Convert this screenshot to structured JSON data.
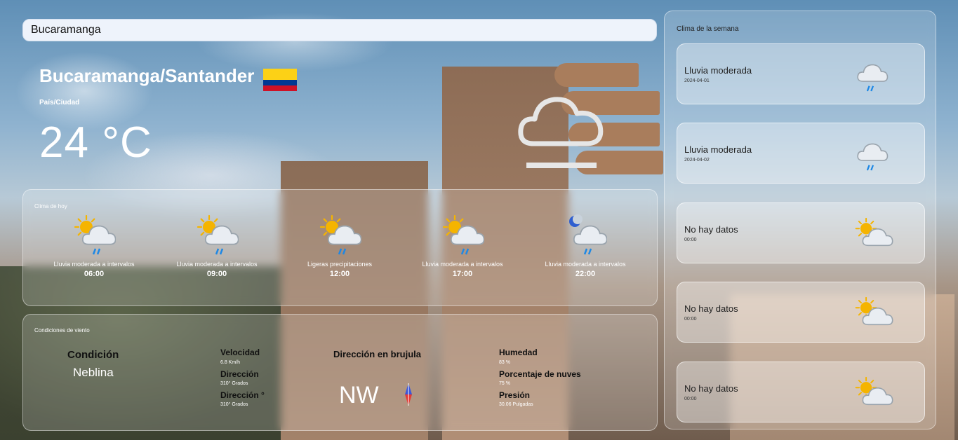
{
  "search": {
    "value": "Bucaramanga"
  },
  "location": {
    "title": "Bucaramanga/Santander",
    "label": "País/Ciudad",
    "temperature": "24 °C",
    "flag_icon": "colombia-flag-icon",
    "icon": "fog-icon"
  },
  "hourly": {
    "title": "Clima de hoy",
    "items": [
      {
        "condition": "Lluvia moderada a intervalos",
        "time": "06:00",
        "icon": "sun-cloud-rain-icon"
      },
      {
        "condition": "Lluvia moderada a intervalos",
        "time": "09:00",
        "icon": "sun-cloud-rain-icon"
      },
      {
        "condition": "Ligeras precipitaciones",
        "time": "12:00",
        "icon": "sun-cloud-rain-icon"
      },
      {
        "condition": "Lluvia moderada a intervalos",
        "time": "17:00",
        "icon": "sun-cloud-rain-icon"
      },
      {
        "condition": "Lluvia moderada a intervalos",
        "time": "22:00",
        "icon": "moon-cloud-rain-icon"
      }
    ]
  },
  "wind": {
    "title": "Condiciones de viento",
    "condicion_label": "Condición",
    "condicion_value": "Neblina",
    "velocidad_label": "Velocidad",
    "velocidad_value": "6.8 Km/h",
    "direccion_label": "Dirección",
    "direccion_value": "310° Grados",
    "direccion2_label": "Dirección °",
    "direccion2_value": "310° Grados",
    "brujula_label": "Dirección en brujula",
    "brujula_value": "NW",
    "humedad_label": "Humedad",
    "humedad_value": "83 %",
    "nubes_label": "Porcentaje de nuves",
    "nubes_value": "75 %",
    "presion_label": "Presión",
    "presion_value": "30.06 Pulgadas"
  },
  "weekly": {
    "title": "Clima de la semana",
    "days": [
      {
        "condition": "Lluvia moderada",
        "date": "2024-04-01",
        "icon": "cloud-rain-icon"
      },
      {
        "condition": "Lluvia moderada",
        "date": "2024-04-02",
        "icon": "cloud-rain-icon"
      },
      {
        "condition": "No hay datos",
        "date": "00:00",
        "icon": "sun-cloud-icon"
      },
      {
        "condition": "No hay datos",
        "date": "00:00",
        "icon": "sun-cloud-icon"
      },
      {
        "condition": "No hay datos",
        "date": "00:00",
        "icon": "sun-cloud-icon"
      }
    ]
  },
  "colors": {
    "rain": "#1e88e5",
    "sun": "#f5b400",
    "cloud": "#e9edf2",
    "search_bg": "#eef3fb"
  }
}
